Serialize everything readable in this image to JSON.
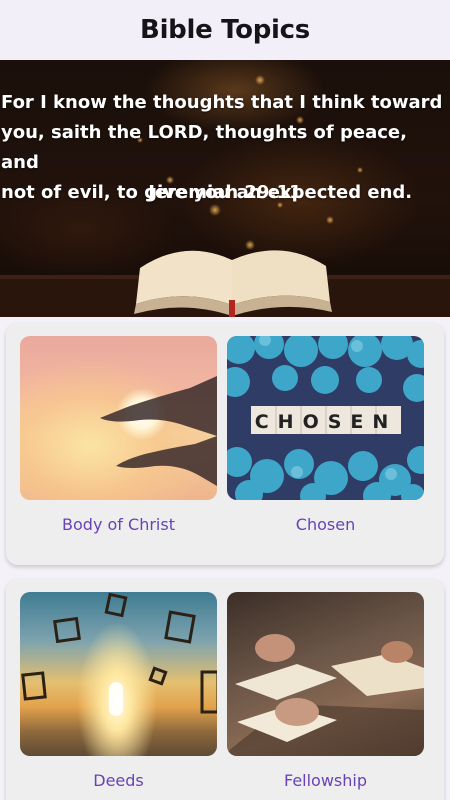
{
  "app_bar": {
    "title": "Bible Topics"
  },
  "hero": {
    "verse_lines": [
      "For I know the thoughts that I think toward",
      "you, saith the LORD, thoughts of peace, and",
      "not of evil, to give you an expected end."
    ],
    "reference": "Jeremiah 29:11"
  },
  "topics": [
    {
      "label": "Body of Christ",
      "image_icon": "hands-light-image"
    },
    {
      "label": "Chosen",
      "image_icon": "chosen-blocks-image",
      "image_text": "CHOSEN"
    },
    {
      "label": "Deeds",
      "image_icon": "frames-sunset-image"
    },
    {
      "label": "Fellowship",
      "image_icon": "praying-hands-bible-image"
    }
  ],
  "colors": {
    "accent": "#6943b5",
    "app_bar_bg": "#f3eff8",
    "card_bg": "#eeeeee"
  }
}
